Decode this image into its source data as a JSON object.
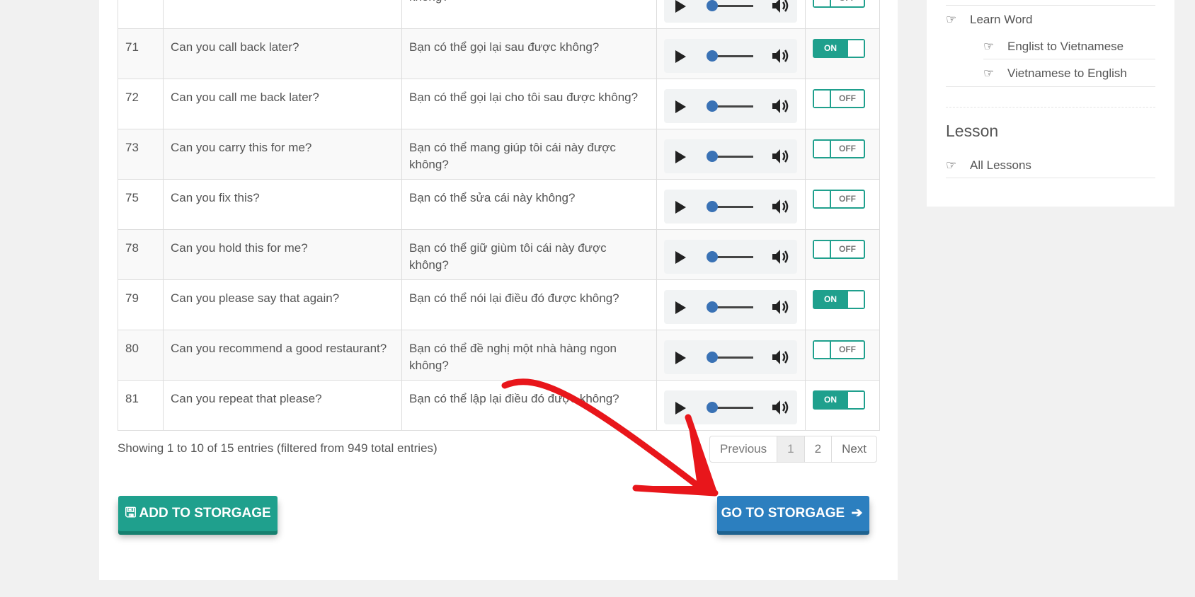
{
  "table": {
    "rows": [
      {
        "id": "",
        "english": "",
        "vietnamese": "không?",
        "toggle": "OFF"
      },
      {
        "id": "71",
        "english": "Can you call back later?",
        "vietnamese": "Bạn có thể gọi lại sau được không?",
        "toggle": "ON"
      },
      {
        "id": "72",
        "english": "Can you call me back later?",
        "vietnamese": "Bạn có thể gọi lại cho tôi sau được không?",
        "toggle": "OFF"
      },
      {
        "id": "73",
        "english": "Can you carry this for me?",
        "vietnamese": "Bạn có thể mang giúp tôi cái này được không?",
        "toggle": "OFF"
      },
      {
        "id": "75",
        "english": "Can you fix this?",
        "vietnamese": "Bạn có thể sửa cái này không?",
        "toggle": "OFF"
      },
      {
        "id": "78",
        "english": "Can you hold this for me?",
        "vietnamese": "Bạn có thể giữ giùm tôi cái này được không?",
        "toggle": "OFF"
      },
      {
        "id": "79",
        "english": "Can you please say that again?",
        "vietnamese": "Bạn có thể nói lại điều đó được không?",
        "toggle": "ON"
      },
      {
        "id": "80",
        "english": "Can you recommend a good restaurant?",
        "vietnamese": "Bạn có thể đề nghị một nhà hàng ngon không?",
        "toggle": "OFF"
      },
      {
        "id": "81",
        "english": "Can you repeat that please?",
        "vietnamese": "Bạn có thể lập lại điều đó được không?",
        "toggle": "ON"
      }
    ]
  },
  "info": "Showing 1 to 10 of 15 entries (filtered from 949 total entries)",
  "pagination": {
    "previous": "Previous",
    "pages": [
      "1",
      "2"
    ],
    "current": "1",
    "next": "Next"
  },
  "buttons": {
    "add": "ADD TO STORGAGE",
    "go": "GO TO STORGAGE"
  },
  "sidebar": {
    "learn_word": "Learn Word",
    "sub_items": [
      "Englist to Vietnamese",
      "Vietnamese to English"
    ],
    "lesson_heading": "Lesson",
    "all_lessons": "All Lessons"
  },
  "colors": {
    "accent_green": "#1fa08d",
    "accent_blue": "#2c7fbf",
    "annotation_red": "#e8161b"
  },
  "icons": {
    "play": "play-icon",
    "volume": "volume-icon",
    "hand": "hand-pointing-right-icon",
    "save": "floppy-disk-icon",
    "arrow": "arrow-right-icon"
  }
}
